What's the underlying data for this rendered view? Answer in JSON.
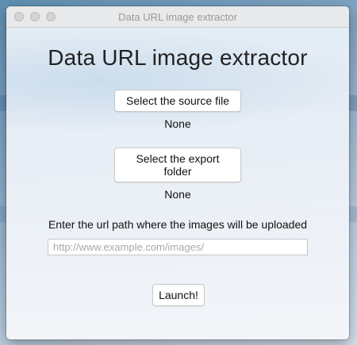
{
  "window": {
    "title": "Data URL image extractor"
  },
  "main": {
    "heading": "Data URL image extractor",
    "source_button_label": "Select the source file",
    "source_status": "None",
    "export_button_label": "Select the export folder",
    "export_status": "None",
    "url_label": "Enter the url path where the images will be uploaded",
    "url_value": "",
    "url_placeholder": "http://www.example.com/images/",
    "launch_button_label": "Launch!"
  }
}
